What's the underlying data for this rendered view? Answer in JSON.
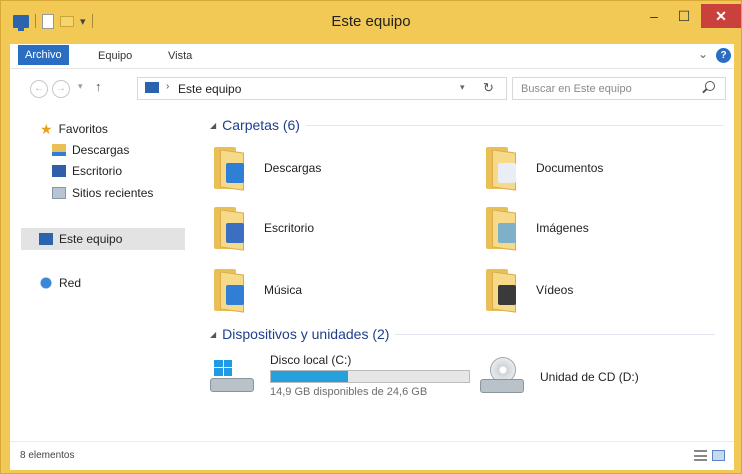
{
  "window": {
    "title": "Este equipo"
  },
  "titlebar": {
    "minimize_glyph": "–",
    "maximize_glyph": "☐",
    "close_glyph": "✕"
  },
  "ribbon": {
    "tabs": [
      {
        "label": "Archivo",
        "active": true
      },
      {
        "label": "Equipo",
        "active": false
      },
      {
        "label": "Vista",
        "active": false
      }
    ],
    "help_glyph": "?"
  },
  "address": {
    "path": [
      "Este equipo"
    ],
    "search_placeholder": "Buscar en Este equipo"
  },
  "nav_pane": {
    "favorites_label": "Favoritos",
    "favorites": [
      "Descargas",
      "Escritorio",
      "Sitios recientes"
    ],
    "this_pc": "Este equipo",
    "network": "Red"
  },
  "main": {
    "folders_group": "Carpetas (6)",
    "folders": [
      {
        "name": "Descargas",
        "icon": "download-folder-icon",
        "badge_color": "#2f7fd6"
      },
      {
        "name": "Documentos",
        "icon": "documents-folder-icon",
        "badge_color": "#e9eef5"
      },
      {
        "name": "Escritorio",
        "icon": "desktop-folder-icon",
        "badge_color": "#3b6fc1"
      },
      {
        "name": "Imágenes",
        "icon": "pictures-folder-icon",
        "badge_color": "#7fb0c9"
      },
      {
        "name": "Música",
        "icon": "music-folder-icon",
        "badge_color": "#2f7fd6"
      },
      {
        "name": "Vídeos",
        "icon": "videos-folder-icon",
        "badge_color": "#3a3a3a"
      }
    ],
    "devices_group": "Dispositivos y unidades (2)",
    "devices": [
      {
        "name": "Disco local (C:)",
        "free_text": "14,9 GB disponibles de 24,6 GB",
        "used_fraction": 0.39
      },
      {
        "name": "Unidad de CD (D:)"
      }
    ]
  },
  "status": {
    "count": "8 elementos"
  },
  "colors": {
    "frame": "#f2c955",
    "accent": "#2a6ec4",
    "close": "#c9413a",
    "group_heading": "#1e3f8a",
    "usage_bar": "#26a0da"
  }
}
